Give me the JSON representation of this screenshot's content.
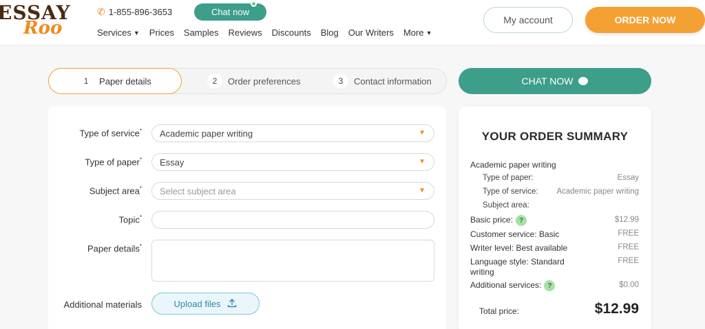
{
  "brand": {
    "line1": "ESSAY",
    "line2": "Roo"
  },
  "header": {
    "phone": "1-855-896-3653",
    "chat_label": "Chat now",
    "nav": [
      {
        "label": "Services",
        "dropdown": true
      },
      {
        "label": "Prices"
      },
      {
        "label": "Samples"
      },
      {
        "label": "Reviews"
      },
      {
        "label": "Discounts"
      },
      {
        "label": "Blog"
      },
      {
        "label": "Our Writers"
      },
      {
        "label": "More",
        "dropdown": true
      }
    ],
    "account_label": "My account",
    "order_label": "ORDER NOW"
  },
  "steps": [
    {
      "num": "1",
      "label": "Paper details"
    },
    {
      "num": "2",
      "label": "Order preferences"
    },
    {
      "num": "3",
      "label": "Contact information"
    }
  ],
  "form": {
    "type_of_service": {
      "label": "Type of service",
      "value": "Academic paper writing"
    },
    "type_of_paper": {
      "label": "Type of paper",
      "value": "Essay"
    },
    "subject_area": {
      "label": "Subject area",
      "placeholder": "Select subject area"
    },
    "topic": {
      "label": "Topic",
      "value": ""
    },
    "paper_details": {
      "label": "Paper details",
      "value": ""
    },
    "additional_materials": {
      "label": "Additional materials",
      "button": "Upload files"
    }
  },
  "chat_big": "CHAT NOW",
  "summary": {
    "title": "YOUR ORDER SUMMARY",
    "service": "Academic paper writing",
    "type_of_paper_label": "Type of paper:",
    "type_of_paper_value": "Essay",
    "type_of_service_label": "Type of service:",
    "type_of_service_value": "Academic paper writing",
    "subject_area_label": "Subject area:",
    "basic_price_label": "Basic price:",
    "basic_price_value": "$12.99",
    "customer_service_label": "Customer service: Basic",
    "customer_service_value": "FREE",
    "writer_level_label": "Writer level: Best available",
    "writer_level_value": "FREE",
    "language_style_label_1": "Language style: Standard",
    "language_style_label_2": "writing",
    "language_style_value": "FREE",
    "additional_services_label": "Additional services:",
    "additional_services_value": "$0.00",
    "total_label": "Total price:",
    "total_value": "$12.99",
    "help_glyph": "?"
  },
  "colors": {
    "accent_orange": "#f5a033",
    "accent_teal": "#3d9e8a",
    "brand_brown": "#4a2a12"
  }
}
